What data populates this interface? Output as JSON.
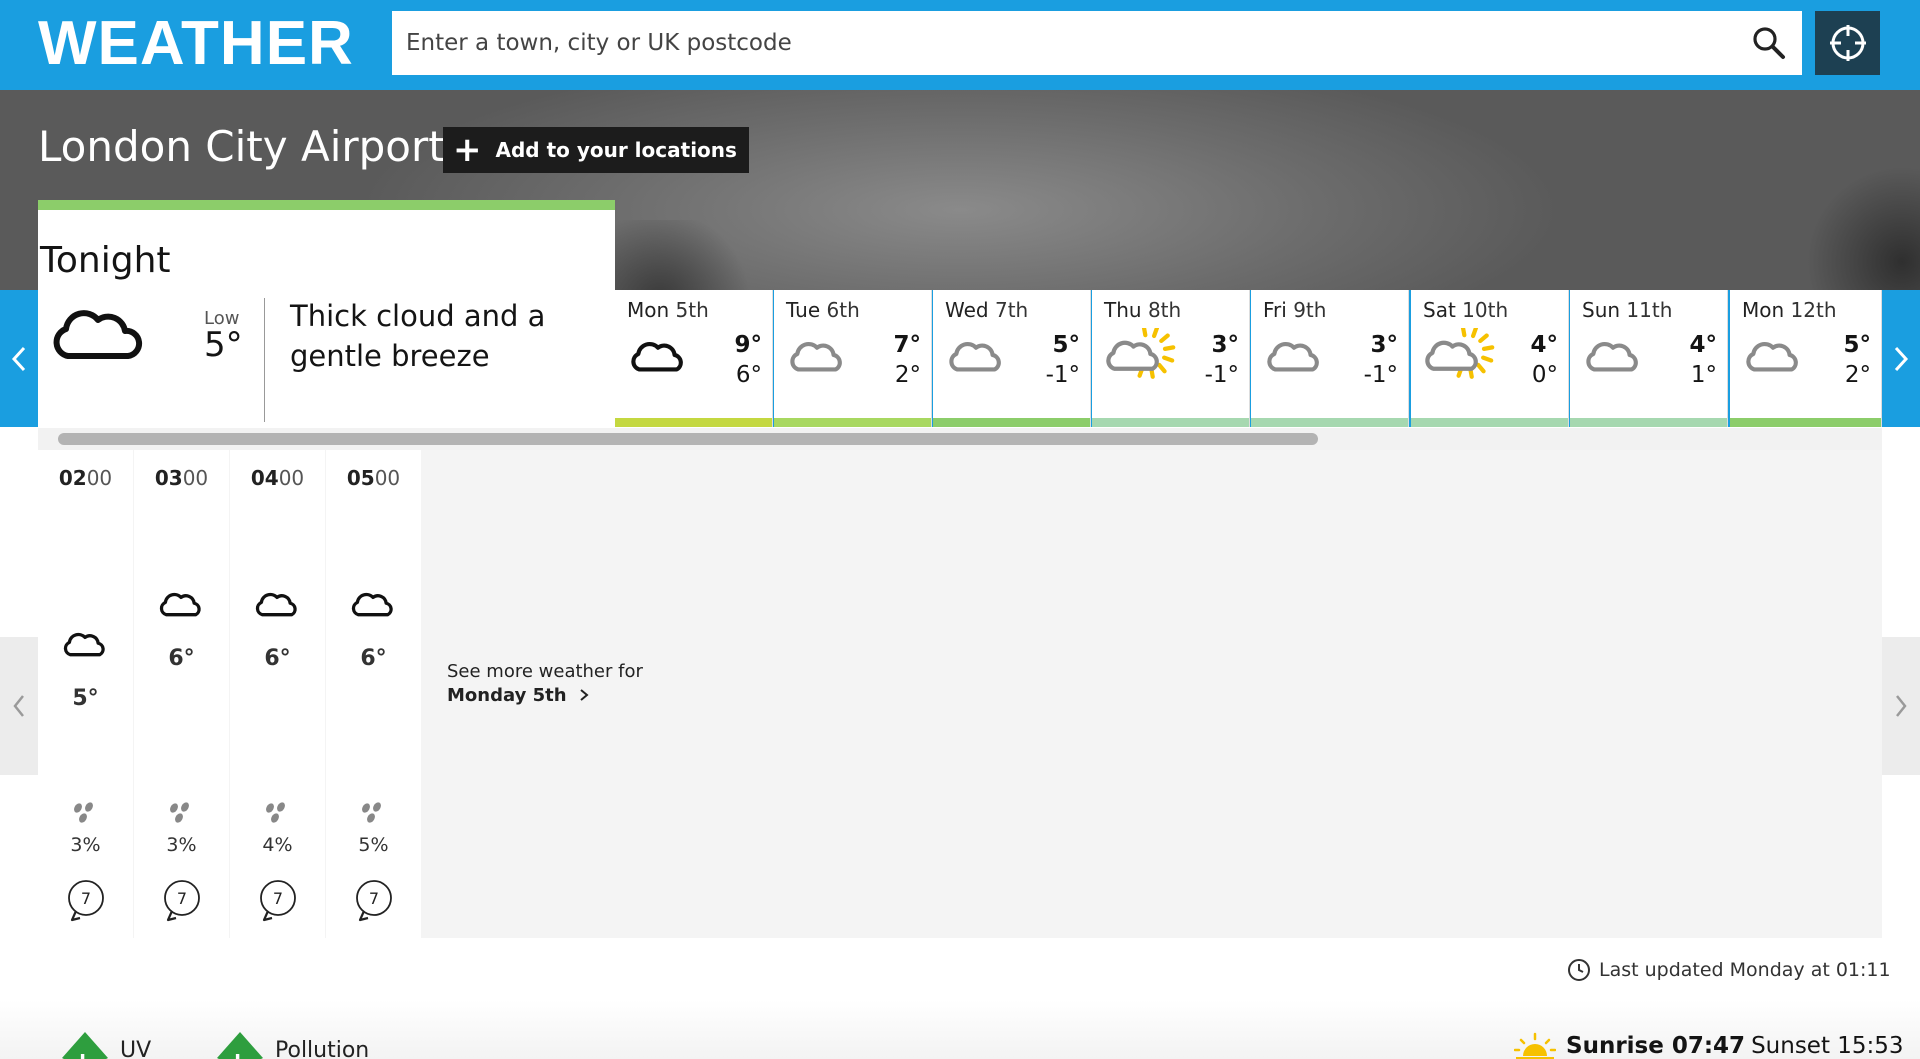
{
  "header": {
    "brand": "WEATHER",
    "search_placeholder": "Enter a town, city or UK postcode"
  },
  "location": {
    "name": "London City Airport",
    "add_label": "Add to your locations"
  },
  "tonight": {
    "title": "Tonight",
    "low_label": "Low",
    "low_value": "5°",
    "description": "Thick cloud and a gentle breeze",
    "icon": "thick-cloud-icon",
    "bar_color": "#8ccd6a"
  },
  "days": [
    {
      "name": "Mon",
      "date": "5th",
      "hi": "9°",
      "lo": "6°",
      "icon": "thick-cloud-icon",
      "bar_color": "#c4d840"
    },
    {
      "name": "Tue",
      "date": "6th",
      "hi": "7°",
      "lo": "2°",
      "icon": "light-cloud-icon",
      "bar_color": "#a8d860"
    },
    {
      "name": "Wed",
      "date": "7th",
      "hi": "5°",
      "lo": "-1°",
      "icon": "light-cloud-icon",
      "bar_color": "#8ccd6a"
    },
    {
      "name": "Thu",
      "date": "8th",
      "hi": "3°",
      "lo": "-1°",
      "icon": "sunny-intervals-icon",
      "bar_color": "#a6d8b0"
    },
    {
      "name": "Fri",
      "date": "9th",
      "hi": "3°",
      "lo": "-1°",
      "icon": "light-cloud-icon",
      "bar_color": "#a6d8b0"
    },
    {
      "name": "Sat",
      "date": "10th",
      "hi": "4°",
      "lo": "0°",
      "icon": "sunny-intervals-icon",
      "bar_color": "#a6d8b0"
    },
    {
      "name": "Sun",
      "date": "11th",
      "hi": "4°",
      "lo": "1°",
      "icon": "light-cloud-icon",
      "bar_color": "#a6d8b0"
    },
    {
      "name": "Mon",
      "date": "12th",
      "hi": "5°",
      "lo": "2°",
      "icon": "light-cloud-icon",
      "bar_color": "#8ccd6a"
    }
  ],
  "hours": [
    {
      "hh": "02",
      "mm": "00",
      "temp": "5°",
      "rain": "3%",
      "wind": "7"
    },
    {
      "hh": "03",
      "mm": "00",
      "temp": "6°",
      "rain": "3%",
      "wind": "7"
    },
    {
      "hh": "04",
      "mm": "00",
      "temp": "6°",
      "rain": "4%",
      "wind": "7"
    },
    {
      "hh": "05",
      "mm": "00",
      "temp": "6°",
      "rain": "5%",
      "wind": "7"
    }
  ],
  "see_more": {
    "line1": "See more weather for",
    "line2": "Monday 5th"
  },
  "last_updated": "Last updated Monday at 01:11",
  "footer": {
    "uv_label": "UV",
    "uv_level": "L",
    "pollution_label": "Pollution",
    "pollution_level": "L",
    "sunrise_label": "Sunrise 07:47",
    "sunset_label": "Sunset 15:53"
  },
  "colors": {
    "header_blue": "#1a9ee0",
    "locate_button": "#1d4052",
    "sun_yellow": "#f6c100",
    "badge_green": "#2e9e3e"
  }
}
